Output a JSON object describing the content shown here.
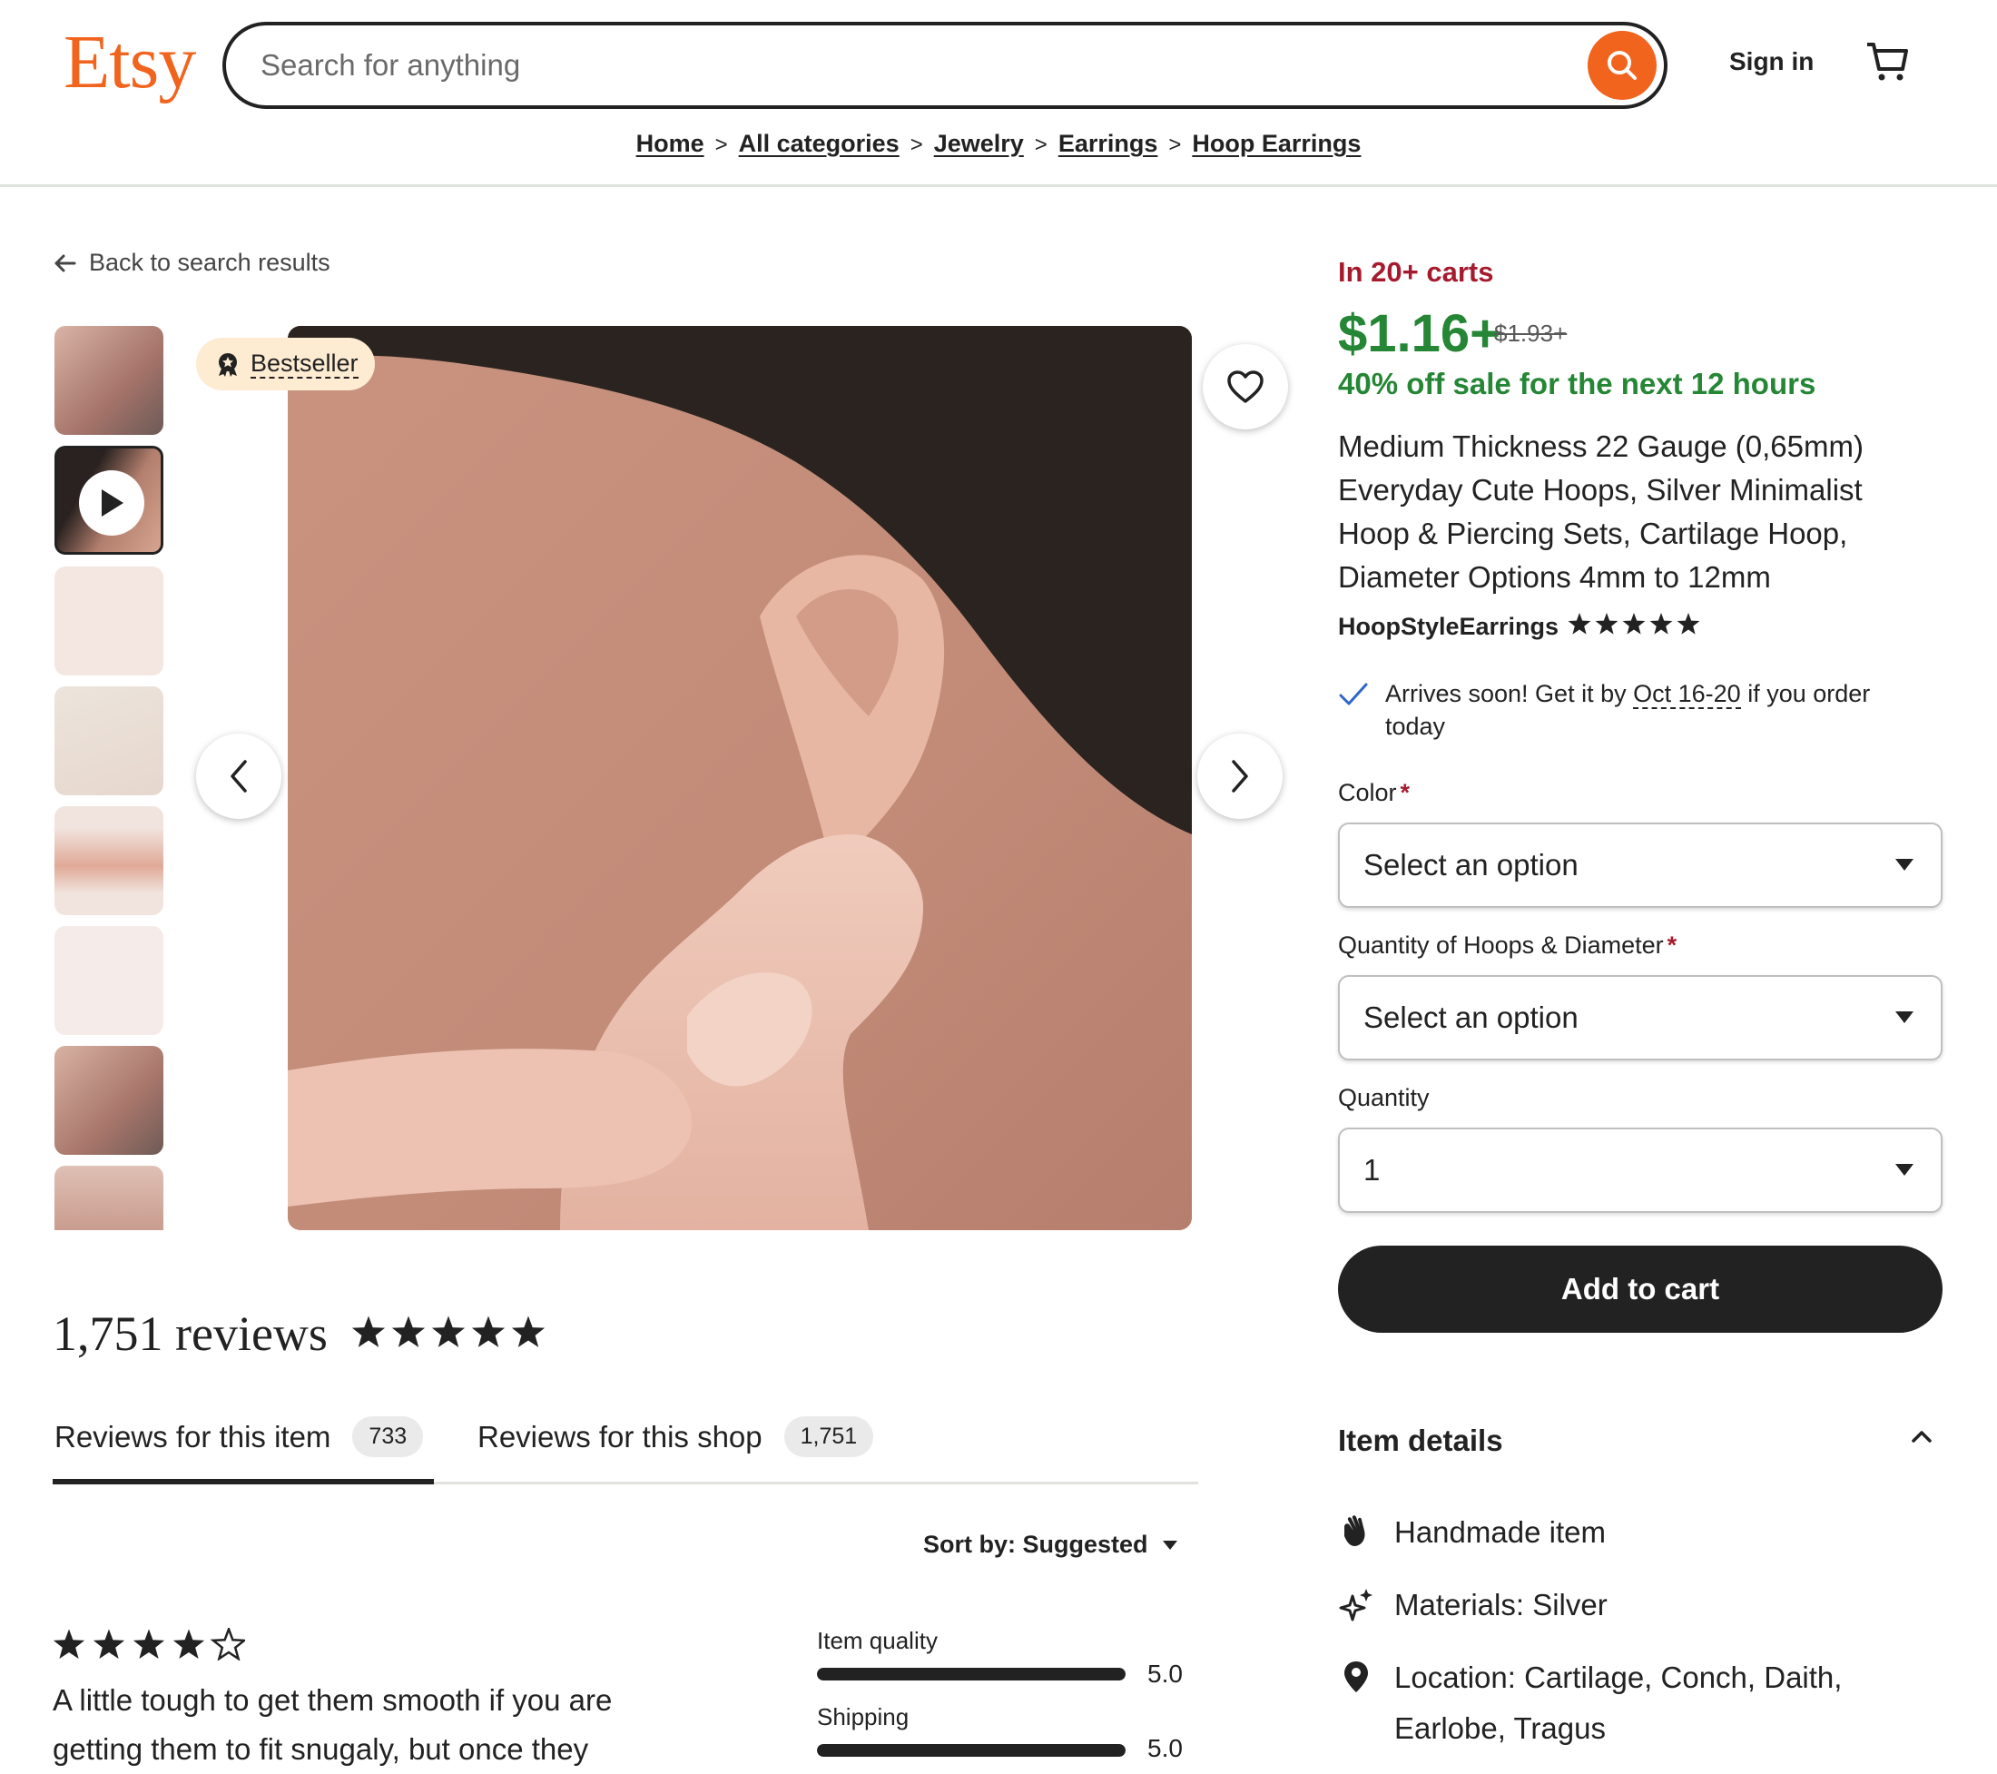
{
  "header": {
    "logo": "Etsy",
    "search_placeholder": "Search for anything",
    "sign_in": "Sign in",
    "breadcrumb": [
      "Home",
      "All categories",
      "Jewelry",
      "Earrings",
      "Hoop Earrings"
    ]
  },
  "gallery": {
    "back_label": "Back to search results",
    "badge": "Bestseller"
  },
  "reviews": {
    "count_label": "1,751 reviews",
    "rating": 5,
    "tabs": [
      {
        "label": "Reviews for this item",
        "count": "733"
      },
      {
        "label": "Reviews for this shop",
        "count": "1,751"
      }
    ],
    "sort_label": "Sort by: Suggested",
    "first_review": {
      "stars": 4,
      "text": "A little tough to get them smooth if you are getting them to fit snugaly, but once they"
    },
    "ratings": [
      {
        "label": "Item quality",
        "value": "5.0",
        "fraction": 1.0
      },
      {
        "label": "Shipping",
        "value": "5.0",
        "fraction": 1.0
      }
    ]
  },
  "product": {
    "in_carts": "In 20+ carts",
    "price": "$1.16+",
    "old_price": "$1.93+",
    "sale": "40% off sale for the next 12 hours",
    "title": "Medium Thickness 22 Gauge (0,65mm) Everyday Cute Hoops, Silver Minimalist Hoop & Piercing Sets, Cartilage Hoop, Diameter Options 4mm to 12mm",
    "shop_name": "HoopStyleEarrings",
    "shop_rating": 5,
    "arrives_prefix": "Arrives soon! Get it by",
    "arrives_date": "Oct 16-20",
    "arrives_suffix": "if you order today",
    "color_label": "Color",
    "color_value": "Select an option",
    "qty_hoops_label": "Quantity of Hoops & Diameter",
    "qty_hoops_value": "Select an option",
    "quantity_label": "Quantity",
    "quantity_value": "1",
    "add_to_cart": "Add to cart",
    "details_heading": "Item details",
    "details": [
      {
        "icon": "hand-icon",
        "text": "Handmade item"
      },
      {
        "icon": "sparkle-icon",
        "text": "Materials: Silver"
      },
      {
        "icon": "location-pin-icon",
        "text": "Location: Cartilage, Conch, Daith, Earlobe, Tragus"
      }
    ]
  },
  "colors": {
    "brand": "#f1641e",
    "sale_green": "#258635",
    "cart_red": "#a61a2e",
    "badge_bg": "#fdebd2"
  }
}
